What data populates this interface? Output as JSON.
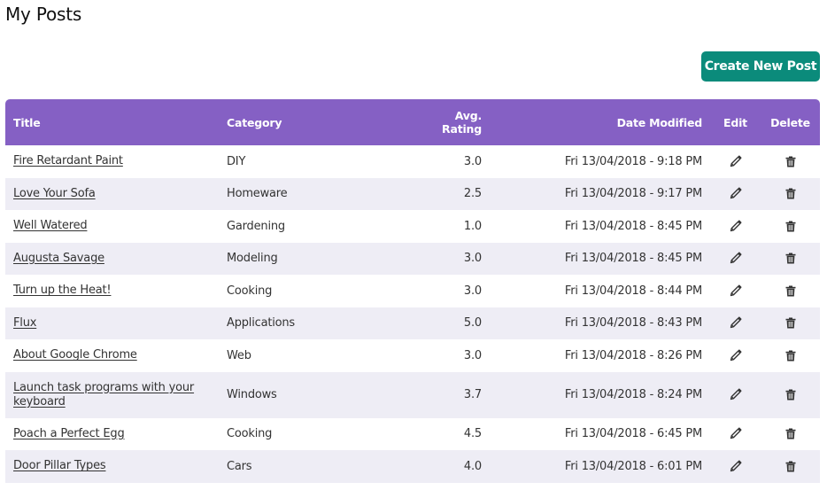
{
  "page": {
    "title": "My Posts"
  },
  "toolbar": {
    "create_label": "Create New Post"
  },
  "colors": {
    "header_bg": "#8560c4",
    "accent": "#0b8b7b",
    "row_alt": "#eeedf5"
  },
  "table": {
    "columns": {
      "title": "Title",
      "category": "Category",
      "rating_line1": "Avg.",
      "rating_line2": "Rating",
      "date": "Date Modified",
      "edit": "Edit",
      "delete": "Delete"
    },
    "icons": {
      "edit": "pencil-icon",
      "delete": "trash-icon"
    },
    "rows": [
      {
        "title": "Fire Retardant Paint",
        "category": "DIY",
        "rating": "3.0",
        "date": "Fri 13/04/2018 - 9:18 PM"
      },
      {
        "title": "Love Your Sofa",
        "category": "Homeware",
        "rating": "2.5",
        "date": "Fri 13/04/2018 - 9:17 PM"
      },
      {
        "title": "Well Watered",
        "category": "Gardening",
        "rating": "1.0",
        "date": "Fri 13/04/2018 - 8:45 PM"
      },
      {
        "title": "Augusta Savage",
        "category": "Modeling",
        "rating": "3.0",
        "date": "Fri 13/04/2018 - 8:45 PM"
      },
      {
        "title": "Turn up the Heat!",
        "category": "Cooking",
        "rating": "3.0",
        "date": "Fri 13/04/2018 - 8:44 PM"
      },
      {
        "title": "Flux",
        "category": "Applications",
        "rating": "5.0",
        "date": "Fri 13/04/2018 - 8:43 PM"
      },
      {
        "title": "About Google Chrome",
        "category": "Web",
        "rating": "3.0",
        "date": "Fri 13/04/2018 - 8:26 PM"
      },
      {
        "title": "Launch task programs with your keyboard",
        "category": "Windows",
        "rating": "3.7",
        "date": "Fri 13/04/2018 - 8:24 PM"
      },
      {
        "title": "Poach a Perfect Egg",
        "category": "Cooking",
        "rating": "4.5",
        "date": "Fri 13/04/2018 - 6:45 PM"
      },
      {
        "title": "Door Pillar Types",
        "category": "Cars",
        "rating": "4.0",
        "date": "Fri 13/04/2018 - 6:01 PM"
      }
    ]
  }
}
